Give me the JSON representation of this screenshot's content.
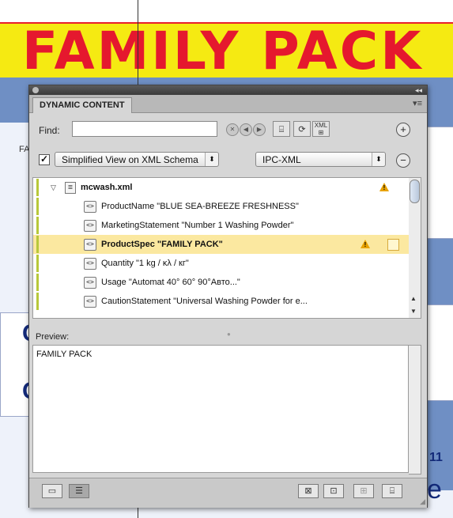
{
  "document": {
    "banner_text": "FAMILY PACK",
    "side_fragment": "FA",
    "right_number": "11",
    "right_glyph": "e",
    "left_glyph": "C",
    "colors": {
      "banner_bg": "#f5ea12",
      "banner_text": "#e5182e",
      "page_blue": "#6f8fc4"
    }
  },
  "palette": {
    "tab_label": "DYNAMIC CONTENT",
    "find": {
      "label": "Find:",
      "value": "",
      "placeholder": ""
    },
    "toolbar_icons": [
      "clear-search-icon",
      "previous-icon",
      "next-icon",
      "show-tags-icon",
      "refresh-icon",
      "xml-mapping-icon",
      "add-icon"
    ],
    "view_select": {
      "checked": true,
      "value": "Simplified View on XML Schema"
    },
    "schema_select": {
      "value": "IPC-XML"
    },
    "tree": {
      "root": {
        "label": "mcwash.xml",
        "warning": true
      },
      "items": [
        {
          "text": "ProductName  \"BLUE SEA-BREEZE FRESHNESS\"",
          "selected": false,
          "warning": false
        },
        {
          "text": "MarketingStatement  \"Number 1 Washing Powder\"",
          "selected": false,
          "warning": false
        },
        {
          "text": "ProductSpec  \"FAMILY PACK\"",
          "selected": true,
          "warning": true
        },
        {
          "text": "Quantity  \"1 kg / κλ / кг\"",
          "selected": false,
          "warning": false
        },
        {
          "text": "Usage  \"Automat 40° 60° 90°Авто...\"",
          "selected": false,
          "warning": false
        },
        {
          "text": "CautionStatement  \"Universal Washing Powder for e...",
          "selected": false,
          "warning": false
        }
      ]
    },
    "preview": {
      "label": "Preview:",
      "text": "FAMILY PACK"
    },
    "bottom_icons": [
      "single-view-icon",
      "list-view-icon",
      "place-content-icon",
      "insert-field-icon",
      "add-frame-icon",
      "fit-frame-icon"
    ]
  }
}
